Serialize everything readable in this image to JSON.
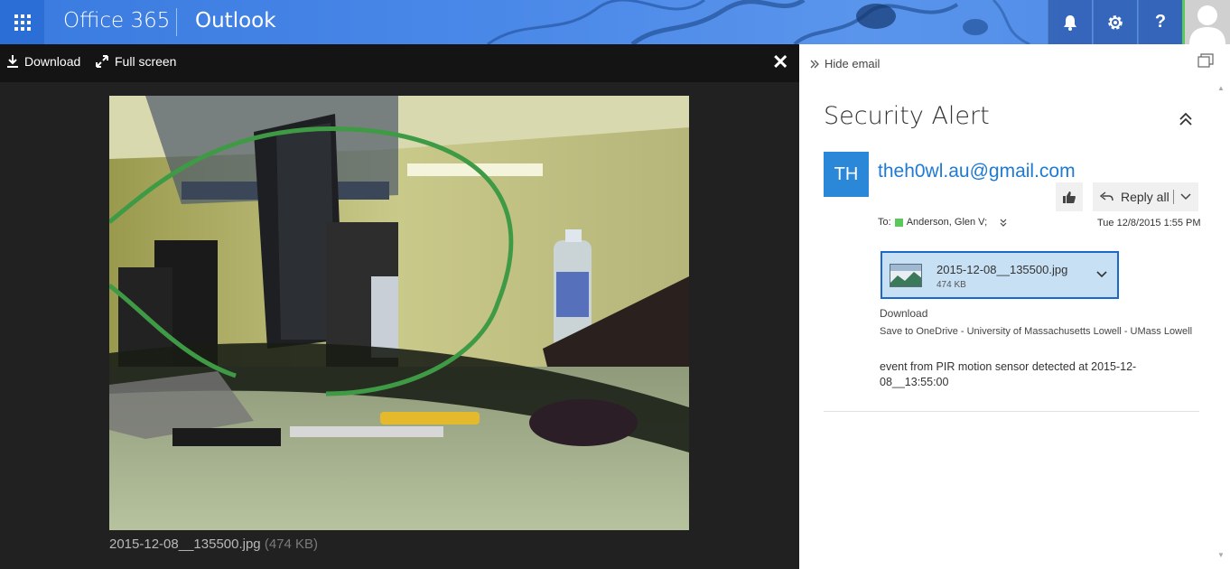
{
  "suite_bar": {
    "brand": "Office 365",
    "app_name": "Outlook",
    "buttons": [
      {
        "icon": "bell-icon"
      },
      {
        "icon": "gear-icon"
      },
      {
        "icon": "help-icon",
        "glyph": "?"
      }
    ]
  },
  "viewer": {
    "download_label": "Download",
    "fullscreen_label": "Full screen",
    "file_name": "2015-12-08__135500.jpg",
    "file_size": "(474 KB)"
  },
  "pane": {
    "hide_email_label": "Hide email",
    "subject": "Security Alert",
    "sender_initials": "TH",
    "sender": "theh0wl.au@gmail.com",
    "reply_label": "Reply all",
    "to_label": "To:",
    "recipient": "Anderson, Glen V;",
    "date": "Tue 12/8/2015 1:55 PM",
    "attachment": {
      "name": "2015-12-08__135500.jpg",
      "size": "474 KB",
      "download_label": "Download",
      "onedrive_label": "Save to OneDrive - University of Massachusetts Lowell - UMass Lowell"
    },
    "body": "event from PIR motion sensor detected at 2015-12-08__13:55:00"
  },
  "colors": {
    "suite_bar": "#3a7be0",
    "accent": "#1f7ad4",
    "avatar": "#2b88d8",
    "attachment_bg": "#c7e0f4",
    "presence": "#5ac85a"
  }
}
